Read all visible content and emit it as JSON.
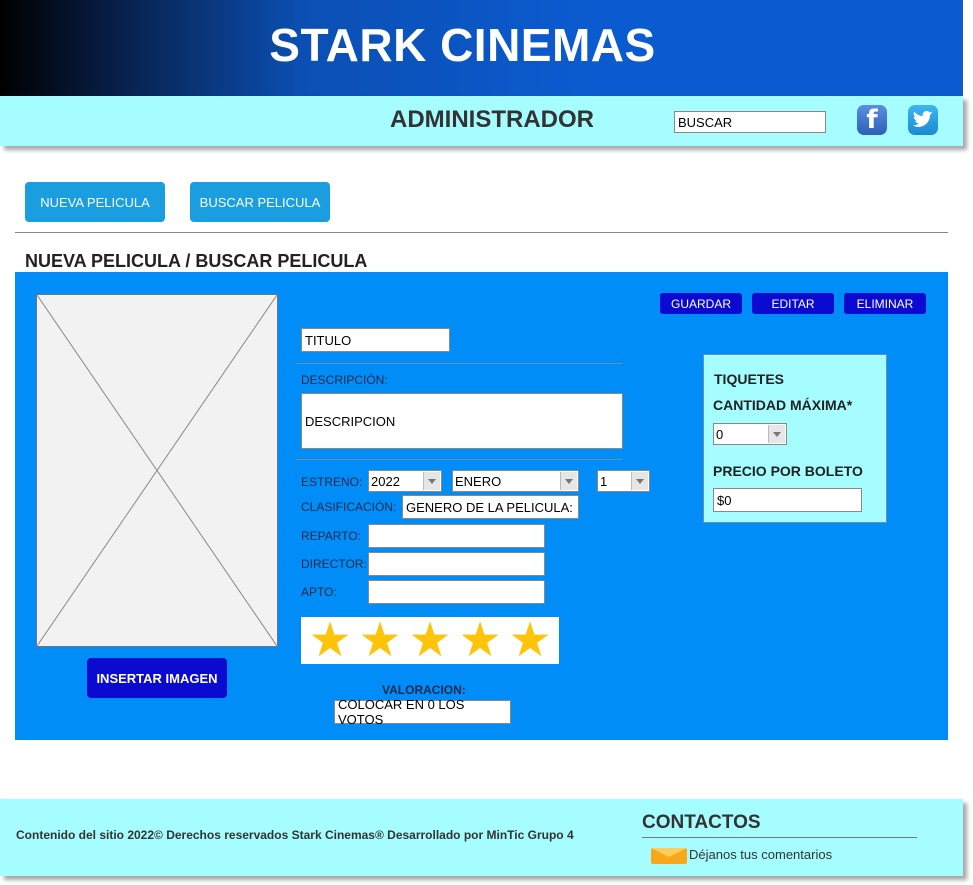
{
  "header": {
    "site_title": "STARK CINEMAS",
    "admin_title": "ADMINISTRADOR",
    "search_value": "BUSCAR"
  },
  "top_buttons": {
    "new_movie": "NUEVA PELICULA",
    "find_movie": "BUSCAR PELICULA"
  },
  "section_title": "NUEVA PELICULA / BUSCAR PELICULA",
  "actions": {
    "save": "GUARDAR",
    "edit": "EDITAR",
    "delete": "ELIMINAR"
  },
  "form": {
    "title_value": "TITULO",
    "description_label": "DESCRIPCIÓN:",
    "description_value": "DESCRIPCION",
    "release_label": "ESTRENO:",
    "year": "2022",
    "month": "ENERO",
    "day": "1",
    "classification_label": "CLASIFICACIÓN:",
    "classification_value": "GENERO DE LA PELICULA:",
    "cast_label": "REPARTO:",
    "director_label": "DIRECTOR:",
    "rated_label": "APTO:",
    "insert_image": "INSERTAR IMAGEN",
    "rating_label": "VALORACION:",
    "rating_stars": 5,
    "reset_votes": "COLOCAR EN 0 LOS VOTOS"
  },
  "tickets": {
    "title": "TIQUETES",
    "max_qty_label": "CANTIDAD MÁXIMA*",
    "max_qty_value": "0",
    "price_label": "PRECIO POR BOLETO",
    "price_value": "$0"
  },
  "footer": {
    "copyright": "Contenido del sitio 2022© Derechos reservados Stark Cinemas® Desarrollado por MinTic Grupo 4",
    "contacts_title": "CONTACTOS",
    "contact_link": "Déjanos tus comentarios"
  },
  "icons": [
    "facebook-icon",
    "twitter-icon",
    "mail-icon",
    "dropdown-arrow-icon",
    "star-icon",
    "image-placeholder-icon"
  ],
  "colors": {
    "panel": "#008df8",
    "button_dark": "#0a0ad0",
    "button_light": "#1a9ee0",
    "light_cyan": "#a5fdff",
    "star": "#fdc40a"
  }
}
